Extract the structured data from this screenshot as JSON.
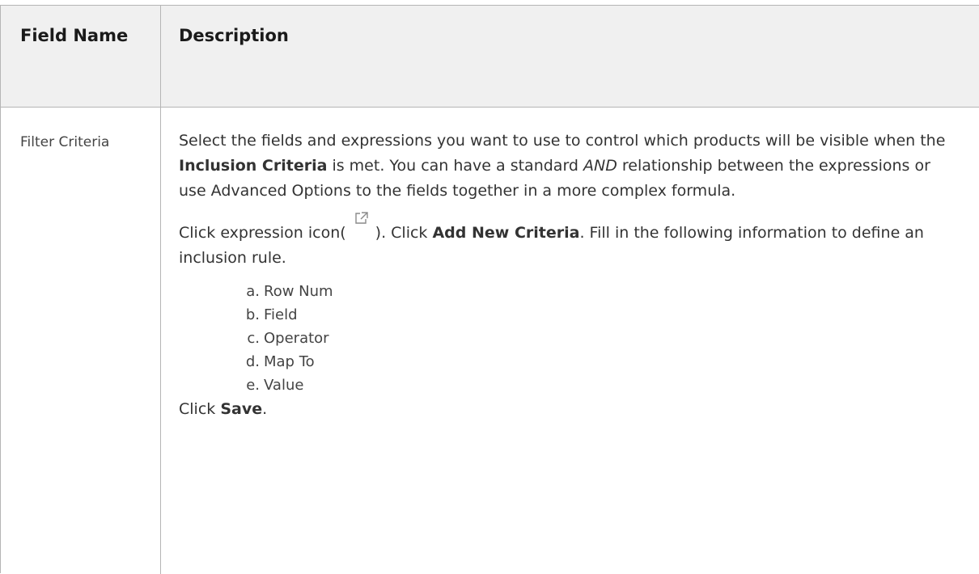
{
  "table": {
    "headers": [
      "Field Name",
      "Description"
    ],
    "rows": [
      {
        "field_name": "Filter Criteria",
        "para1": {
          "t1": "Select the fields and expressions you want to use to control which products will be visible when the ",
          "b1": "Inclusion Criteria",
          "t2": " is met. You can have a standard ",
          "i1": "AND",
          "t3": " relationship between the expressions or use Advanced Options to the fields together in a more complex formula."
        },
        "para2": {
          "t1": "Click expression icon(",
          "icon": "external-link-icon",
          "t2": "). Click ",
          "b1": "Add New Criteria",
          "t3": ". Fill in the following information to define an inclusion rule."
        },
        "steps": [
          {
            "marker": "a.",
            "label": "Row Num"
          },
          {
            "marker": "b.",
            "label": "Field"
          },
          {
            "marker": "c.",
            "label": "Operator"
          },
          {
            "marker": "d.",
            "label": "Map To"
          },
          {
            "marker": "e.",
            "label": "Value"
          }
        ],
        "closing": {
          "t1": "Click ",
          "b1": "Save",
          "t2": "."
        }
      }
    ]
  }
}
